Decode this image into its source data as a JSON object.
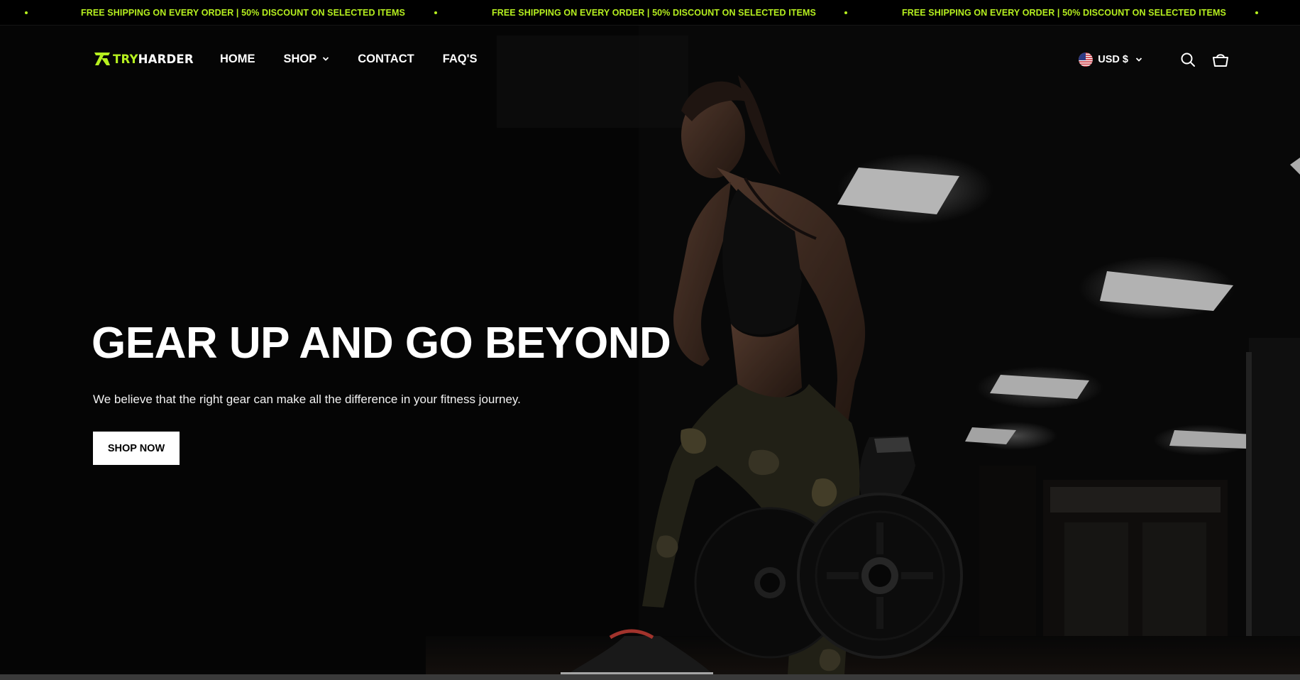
{
  "announcement": {
    "text": "FREE SHIPPING ON EVERY ORDER | 50% DISCOUNT ON SELECTED ITEMS",
    "accent_color": "#b6f01f"
  },
  "header": {
    "logo": {
      "part1": "TRY",
      "part2": "HARDER",
      "icon": "tryharder-logo-icon"
    },
    "nav": [
      {
        "label": "HOME"
      },
      {
        "label": "SHOP",
        "icon": "chevron-down-icon"
      },
      {
        "label": "CONTACT"
      },
      {
        "label": "FAQ'S"
      }
    ],
    "currency": {
      "label": "USD $",
      "icon": "us-flag-icon"
    },
    "icons": [
      "search-icon",
      "cart-icon"
    ]
  },
  "hero": {
    "title": "GEAR UP AND GO BEYOND",
    "subtitle": "We believe that the right gear can make all the difference in your fitness journey.",
    "cta_label": "SHOP NOW",
    "background": "woman-lifting-weight-plate-gym-photo"
  },
  "colors": {
    "accent": "#b6f01f",
    "background": "#000000",
    "text": "#ffffff"
  }
}
